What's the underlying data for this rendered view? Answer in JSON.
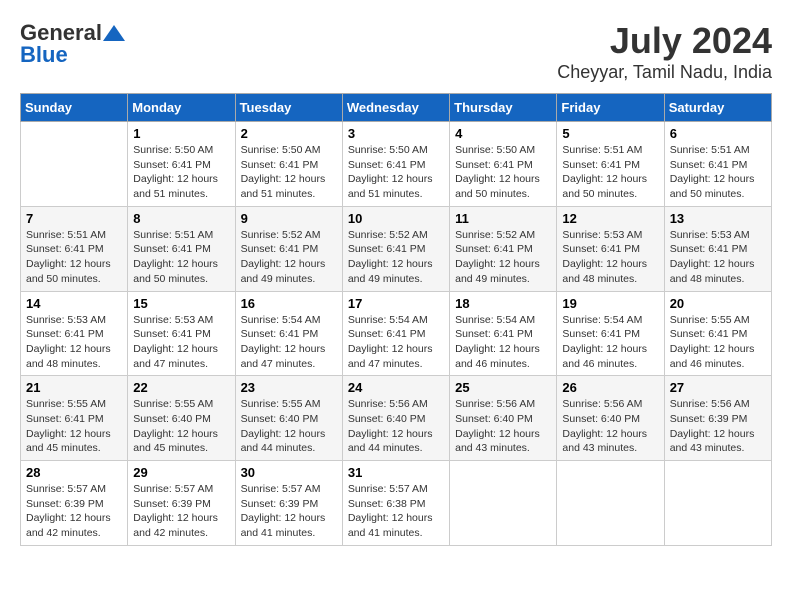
{
  "logo": {
    "general": "General",
    "blue": "Blue"
  },
  "title": "July 2024",
  "subtitle": "Cheyyar, Tamil Nadu, India",
  "days_of_week": [
    "Sunday",
    "Monday",
    "Tuesday",
    "Wednesday",
    "Thursday",
    "Friday",
    "Saturday"
  ],
  "weeks": [
    [
      {
        "day": "",
        "details": ""
      },
      {
        "day": "1",
        "details": "Sunrise: 5:50 AM\nSunset: 6:41 PM\nDaylight: 12 hours\nand 51 minutes."
      },
      {
        "day": "2",
        "details": "Sunrise: 5:50 AM\nSunset: 6:41 PM\nDaylight: 12 hours\nand 51 minutes."
      },
      {
        "day": "3",
        "details": "Sunrise: 5:50 AM\nSunset: 6:41 PM\nDaylight: 12 hours\nand 51 minutes."
      },
      {
        "day": "4",
        "details": "Sunrise: 5:50 AM\nSunset: 6:41 PM\nDaylight: 12 hours\nand 50 minutes."
      },
      {
        "day": "5",
        "details": "Sunrise: 5:51 AM\nSunset: 6:41 PM\nDaylight: 12 hours\nand 50 minutes."
      },
      {
        "day": "6",
        "details": "Sunrise: 5:51 AM\nSunset: 6:41 PM\nDaylight: 12 hours\nand 50 minutes."
      }
    ],
    [
      {
        "day": "7",
        "details": "Sunrise: 5:51 AM\nSunset: 6:41 PM\nDaylight: 12 hours\nand 50 minutes."
      },
      {
        "day": "8",
        "details": "Sunrise: 5:51 AM\nSunset: 6:41 PM\nDaylight: 12 hours\nand 50 minutes."
      },
      {
        "day": "9",
        "details": "Sunrise: 5:52 AM\nSunset: 6:41 PM\nDaylight: 12 hours\nand 49 minutes."
      },
      {
        "day": "10",
        "details": "Sunrise: 5:52 AM\nSunset: 6:41 PM\nDaylight: 12 hours\nand 49 minutes."
      },
      {
        "day": "11",
        "details": "Sunrise: 5:52 AM\nSunset: 6:41 PM\nDaylight: 12 hours\nand 49 minutes."
      },
      {
        "day": "12",
        "details": "Sunrise: 5:53 AM\nSunset: 6:41 PM\nDaylight: 12 hours\nand 48 minutes."
      },
      {
        "day": "13",
        "details": "Sunrise: 5:53 AM\nSunset: 6:41 PM\nDaylight: 12 hours\nand 48 minutes."
      }
    ],
    [
      {
        "day": "14",
        "details": "Sunrise: 5:53 AM\nSunset: 6:41 PM\nDaylight: 12 hours\nand 48 minutes."
      },
      {
        "day": "15",
        "details": "Sunrise: 5:53 AM\nSunset: 6:41 PM\nDaylight: 12 hours\nand 47 minutes."
      },
      {
        "day": "16",
        "details": "Sunrise: 5:54 AM\nSunset: 6:41 PM\nDaylight: 12 hours\nand 47 minutes."
      },
      {
        "day": "17",
        "details": "Sunrise: 5:54 AM\nSunset: 6:41 PM\nDaylight: 12 hours\nand 47 minutes."
      },
      {
        "day": "18",
        "details": "Sunrise: 5:54 AM\nSunset: 6:41 PM\nDaylight: 12 hours\nand 46 minutes."
      },
      {
        "day": "19",
        "details": "Sunrise: 5:54 AM\nSunset: 6:41 PM\nDaylight: 12 hours\nand 46 minutes."
      },
      {
        "day": "20",
        "details": "Sunrise: 5:55 AM\nSunset: 6:41 PM\nDaylight: 12 hours\nand 46 minutes."
      }
    ],
    [
      {
        "day": "21",
        "details": "Sunrise: 5:55 AM\nSunset: 6:41 PM\nDaylight: 12 hours\nand 45 minutes."
      },
      {
        "day": "22",
        "details": "Sunrise: 5:55 AM\nSunset: 6:40 PM\nDaylight: 12 hours\nand 45 minutes."
      },
      {
        "day": "23",
        "details": "Sunrise: 5:55 AM\nSunset: 6:40 PM\nDaylight: 12 hours\nand 44 minutes."
      },
      {
        "day": "24",
        "details": "Sunrise: 5:56 AM\nSunset: 6:40 PM\nDaylight: 12 hours\nand 44 minutes."
      },
      {
        "day": "25",
        "details": "Sunrise: 5:56 AM\nSunset: 6:40 PM\nDaylight: 12 hours\nand 43 minutes."
      },
      {
        "day": "26",
        "details": "Sunrise: 5:56 AM\nSunset: 6:40 PM\nDaylight: 12 hours\nand 43 minutes."
      },
      {
        "day": "27",
        "details": "Sunrise: 5:56 AM\nSunset: 6:39 PM\nDaylight: 12 hours\nand 43 minutes."
      }
    ],
    [
      {
        "day": "28",
        "details": "Sunrise: 5:57 AM\nSunset: 6:39 PM\nDaylight: 12 hours\nand 42 minutes."
      },
      {
        "day": "29",
        "details": "Sunrise: 5:57 AM\nSunset: 6:39 PM\nDaylight: 12 hours\nand 42 minutes."
      },
      {
        "day": "30",
        "details": "Sunrise: 5:57 AM\nSunset: 6:39 PM\nDaylight: 12 hours\nand 41 minutes."
      },
      {
        "day": "31",
        "details": "Sunrise: 5:57 AM\nSunset: 6:38 PM\nDaylight: 12 hours\nand 41 minutes."
      },
      {
        "day": "",
        "details": ""
      },
      {
        "day": "",
        "details": ""
      },
      {
        "day": "",
        "details": ""
      }
    ]
  ]
}
